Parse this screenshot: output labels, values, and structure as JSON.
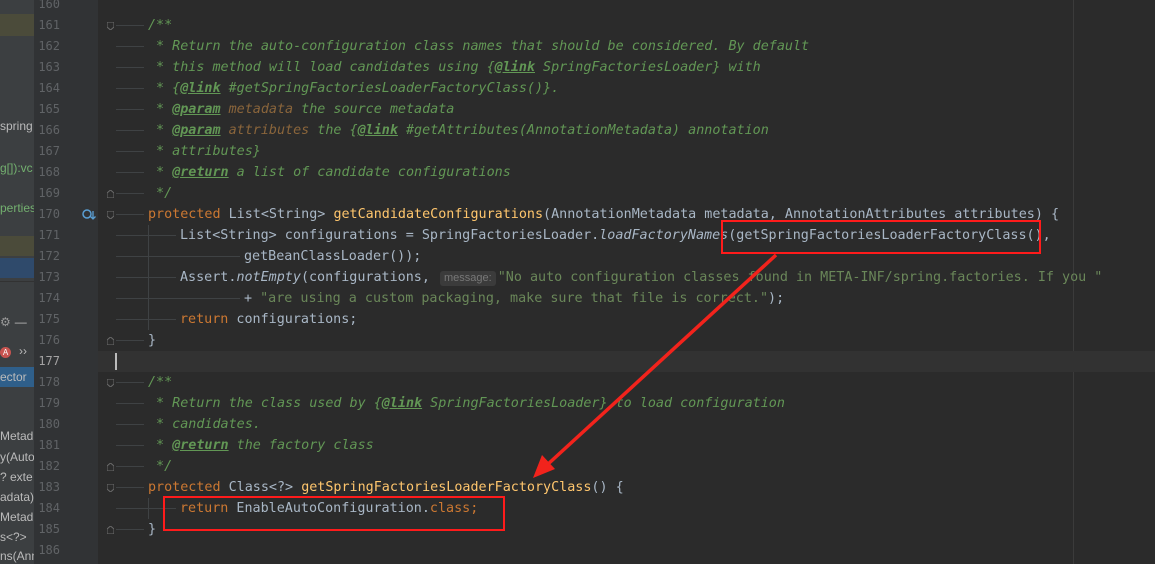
{
  "left_panel": {
    "fragments": [
      "spring",
      "g[]):vc",
      "perties",
      "ector",
      "Metad",
      "y(Auto",
      "? exte",
      "adata)",
      "Metad",
      "s<?>",
      "ns(Ann"
    ]
  },
  "gutter": {
    "line_numbers": [
      "160",
      "161",
      "162",
      "163",
      "164",
      "165",
      "166",
      "167",
      "168",
      "169",
      "170",
      "171",
      "172",
      "173",
      "174",
      "175",
      "176",
      "177",
      "178",
      "179",
      "180",
      "181",
      "182",
      "183",
      "184",
      "185",
      "186"
    ]
  },
  "code": {
    "l161": "/**",
    "l162": " * Return the auto-configuration class names that should be considered. By default",
    "l163a": " * this method will load candidates using {",
    "l163b": "@link",
    "l163c": " SpringFactoriesLoader} with",
    "l164a": " * {",
    "l164b": "@link",
    "l164c": " #getSpringFactoriesLoaderFactoryClass()}.",
    "l165a": " * ",
    "l165b": "@param",
    "l165c": " metadata",
    "l165d": " the source metadata",
    "l166a": " * ",
    "l166b": "@param",
    "l166c": " attributes",
    "l166d": " the {",
    "l166e": "@link",
    "l166f": " #getAttributes(AnnotationMetadata) annotation",
    "l167": " * attributes}",
    "l168a": " * ",
    "l168b": "@return",
    "l168c": " a list of candidate configurations",
    "l169": " */",
    "l170a": "protected",
    "l170b": " List<String> ",
    "l170c": "getCandidateConfigurations",
    "l170d": "(AnnotationMetadata metadata, AnnotationAttributes attributes) {",
    "l171a": "List<String> configurations = SpringFactoriesLoader.",
    "l171b": "loadFactoryNames",
    "l171c": "(getSpringFactoriesLoaderFactoryClass(),",
    "l172": "getBeanClassLoader());",
    "l173a": "Assert.",
    "l173b": "notEmpty",
    "l173c": "(configurations, ",
    "l173hint": "message:",
    "l173d": "\"No auto configuration classes found in META-INF/spring.factories. If you \"",
    "l174a": "+ ",
    "l174b": "\"are using a custom packaging, make sure that file is correct.\"",
    "l174c": ");",
    "l175a": "return",
    "l175b": " configurations;",
    "l176": "}",
    "l178": "/**",
    "l179a": " * Return the class used by {",
    "l179b": "@link",
    "l179c": " SpringFactoriesLoader} to load configuration",
    "l180": " * candidates.",
    "l181a": " * ",
    "l181b": "@return",
    "l181c": " the factory class",
    "l182": " */",
    "l183a": "protected",
    "l183b": " Class<?> ",
    "l183c": "getSpringFactoriesLoaderFactoryClass",
    "l183d": "() {",
    "l184a": "return",
    "l184b": " EnableAutoConfiguration.",
    "l184c": "class",
    "l184d": ";",
    "l185": "}"
  },
  "colors": {
    "background": "#2b2b2b",
    "keyword": "#cc7832",
    "doc_comment": "#629755",
    "method": "#ffc66d",
    "string": "#6a8759",
    "annotation_box": "#ff1b1b",
    "arrow": "#f2231c"
  }
}
